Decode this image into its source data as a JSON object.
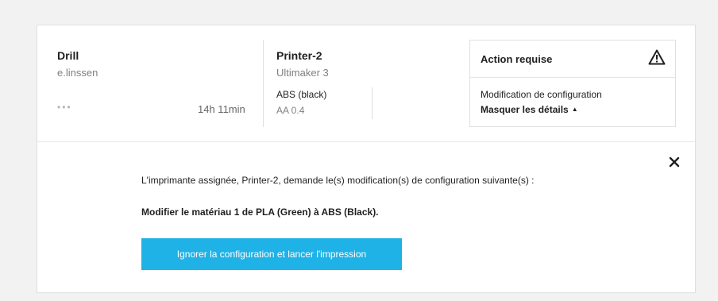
{
  "job": {
    "name": "Drill",
    "owner": "e.linssen",
    "menu_dots": "•••",
    "duration": "14h 11min"
  },
  "printer": {
    "name": "Printer-2",
    "model": "Ultimaker 3",
    "material": "ABS (black)",
    "nozzle": "AA 0.4"
  },
  "action": {
    "title": "Action requise",
    "message": "Modification de configuration",
    "toggle_label": "Masquer les détails",
    "toggle_caret": "▲"
  },
  "details": {
    "info": "L'imprimante assignée, Printer-2, demande le(s) modification(s) de configuration suivante(s) :",
    "change": "Modifier le matériau 1 de PLA (Green) à ABS (Black).",
    "ignore_button_label": "Ignorer la configuration et lancer l'impression"
  },
  "colors": {
    "accent": "#1fb2e6",
    "background": "#f2f2f2",
    "card": "#ffffff"
  },
  "icons": {
    "warning": "warning-icon",
    "close": "close-icon"
  }
}
